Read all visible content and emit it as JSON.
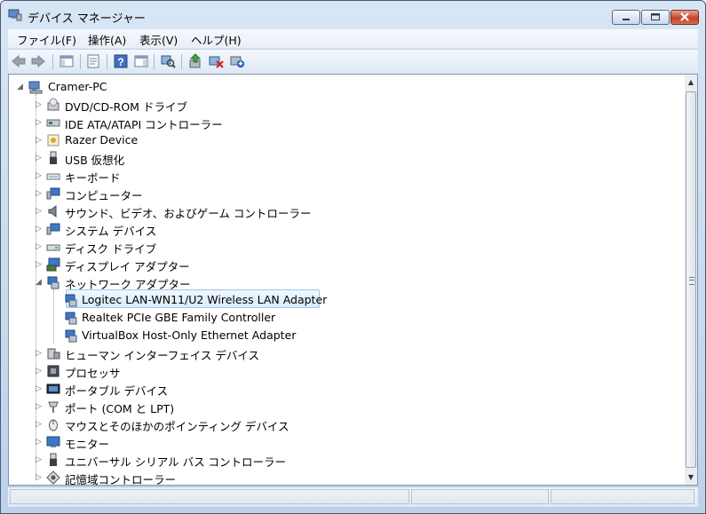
{
  "window": {
    "title": "デバイス マネージャー"
  },
  "menu": [
    {
      "label": "ファイル(F)"
    },
    {
      "label": "操作(A)"
    },
    {
      "label": "表示(V)"
    },
    {
      "label": "ヘルプ(H)"
    }
  ],
  "toolbar": {
    "icons": [
      "back-arrow-icon",
      "forward-arrow-icon",
      "show-hide-console-tree-icon",
      "properties-icon",
      "help-icon",
      "action-pane-icon",
      "scan-hardware-icon",
      "update-driver-icon",
      "disable-device-icon",
      "uninstall-device-icon"
    ]
  },
  "tree": {
    "root": "Cramer-PC",
    "nodes": [
      {
        "label": "DVD/CD-ROM ドライブ",
        "icon": "dvd-drive-icon"
      },
      {
        "label": "IDE ATA/ATAPI コントローラー",
        "icon": "ide-controller-icon"
      },
      {
        "label": "Razer Device",
        "icon": "razer-device-icon"
      },
      {
        "label": "USB 仮想化",
        "icon": "usb-icon"
      },
      {
        "label": "キーボード",
        "icon": "keyboard-icon"
      },
      {
        "label": "コンピューター",
        "icon": "computer-icon"
      },
      {
        "label": "サウンド、ビデオ、およびゲーム コントローラー",
        "icon": "speaker-icon"
      },
      {
        "label": "システム デバイス",
        "icon": "system-device-icon"
      },
      {
        "label": "ディスク ドライブ",
        "icon": "disk-drive-icon"
      },
      {
        "label": "ディスプレイ アダプター",
        "icon": "display-adapter-icon"
      },
      {
        "label": "ネットワーク アダプター",
        "icon": "network-adapter-icon",
        "expanded": true
      },
      {
        "label": "ヒューマン インターフェイス デバイス",
        "icon": "hid-icon"
      },
      {
        "label": "プロセッサ",
        "icon": "processor-icon"
      },
      {
        "label": "ポータブル デバイス",
        "icon": "portable-device-icon"
      },
      {
        "label": "ポート (COM と LPT)",
        "icon": "port-icon"
      },
      {
        "label": "マウスとそのほかのポインティング デバイス",
        "icon": "mouse-icon"
      },
      {
        "label": "モニター",
        "icon": "monitor-icon"
      },
      {
        "label": "ユニバーサル シリアル バス コントローラー",
        "icon": "usb-controller-icon"
      },
      {
        "label": "記憶域コントローラー",
        "icon": "storage-controller-icon"
      }
    ],
    "network_children": [
      {
        "label": "Logitec LAN-WN11/U2 Wireless LAN Adapter",
        "selected": true
      },
      {
        "label": "Realtek PCIe GBE Family Controller"
      },
      {
        "label": "VirtualBox Host-Only Ethernet Adapter"
      }
    ]
  },
  "colors": {
    "selection_border": "#99c8ef",
    "selection_fill": "#dbecfb",
    "title_bar": "#bcd2ea"
  }
}
